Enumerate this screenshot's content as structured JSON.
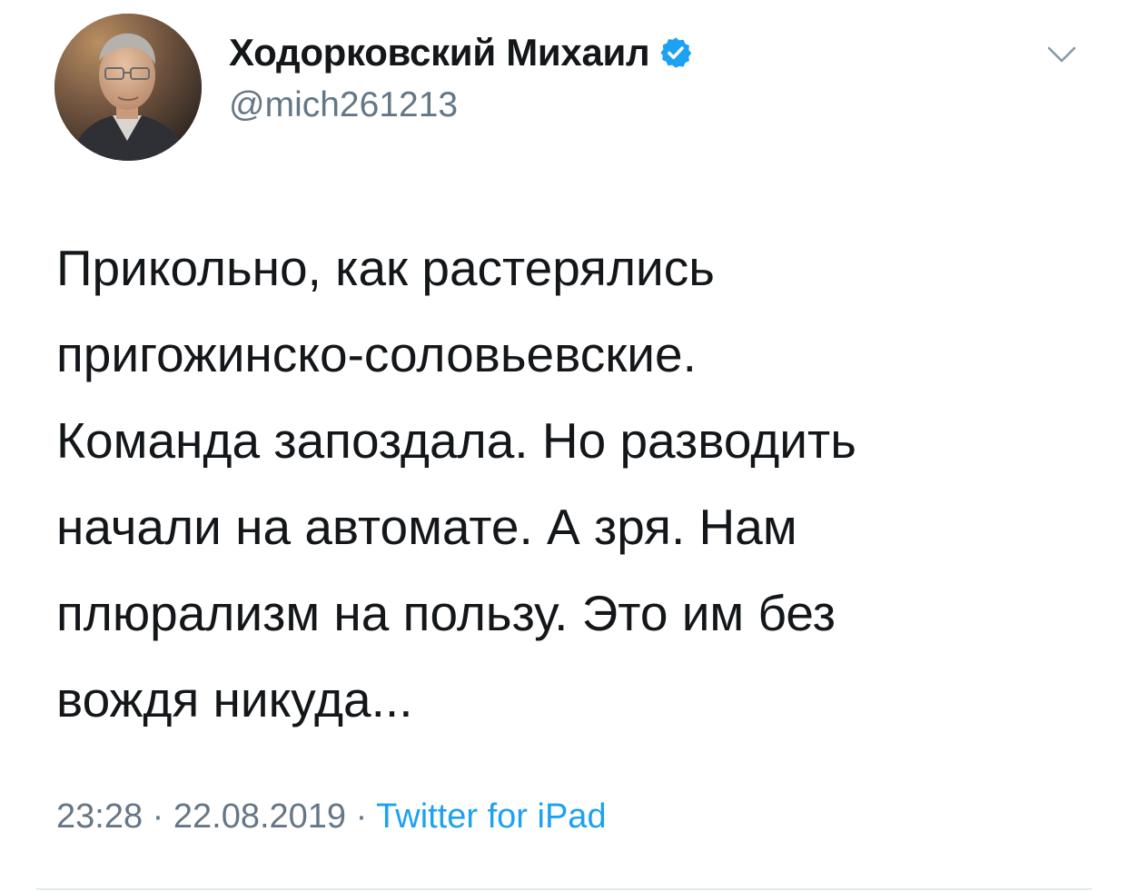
{
  "tweet": {
    "display_name": "Ходорковский Михаил",
    "handle": "@mich261213",
    "verified_icon": "verified-badge-icon",
    "text_lines": [
      "Прикольно, как растерялись",
      "пригожинско-соловьевские.",
      "Команда запоздала. Но разводить",
      "начали на автомате. А зря. Нам",
      "плюрализм на пользу. Это им без",
      "вождя никуда..."
    ],
    "time": "23:28",
    "date": "22.08.2019",
    "separator": " · ",
    "source": "Twitter for iPad"
  },
  "colors": {
    "text": "#14171a",
    "secondary": "#657786",
    "accent": "#1da1f2",
    "divider": "#e1e8ed"
  }
}
